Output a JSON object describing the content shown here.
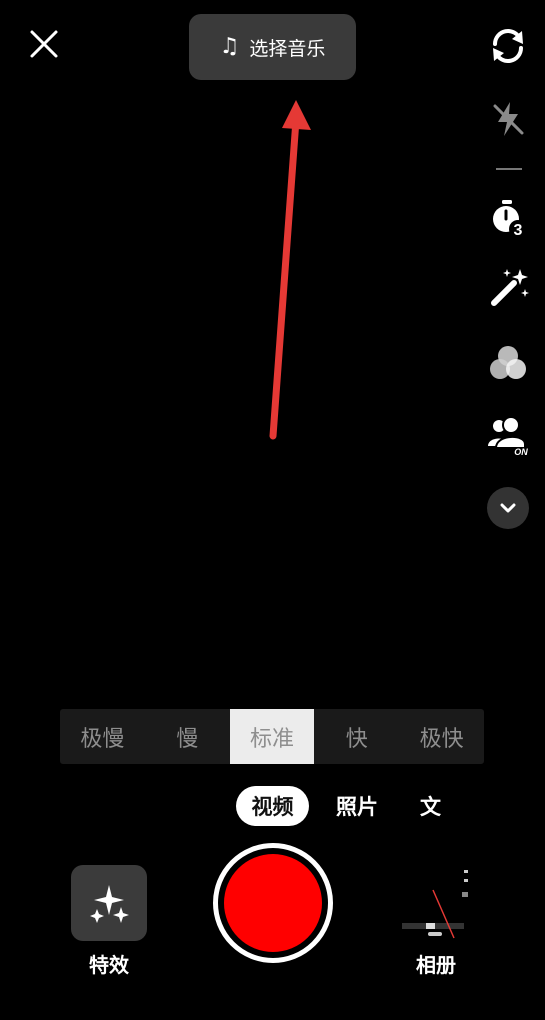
{
  "top": {
    "music_label": "选择音乐",
    "music_icon": "♫"
  },
  "right_toolbar": [
    {
      "name": "flip-camera-icon"
    },
    {
      "name": "flash-off-icon"
    },
    {
      "name": "timer-icon",
      "badge": "3"
    },
    {
      "name": "beauty-wand-icon"
    },
    {
      "name": "filter-icon"
    },
    {
      "name": "duet-icon",
      "badge": "ON"
    },
    {
      "name": "chevron-down-icon"
    }
  ],
  "speed": {
    "options": [
      "极慢",
      "慢",
      "标准",
      "快",
      "极快"
    ],
    "selected": "标准"
  },
  "modes": {
    "video": "视频",
    "photo": "照片",
    "text": "文"
  },
  "bottom": {
    "effects_label": "特效",
    "album_label": "相册"
  },
  "colors": {
    "record": "#ff0000",
    "annotation_arrow": "#e53935"
  }
}
